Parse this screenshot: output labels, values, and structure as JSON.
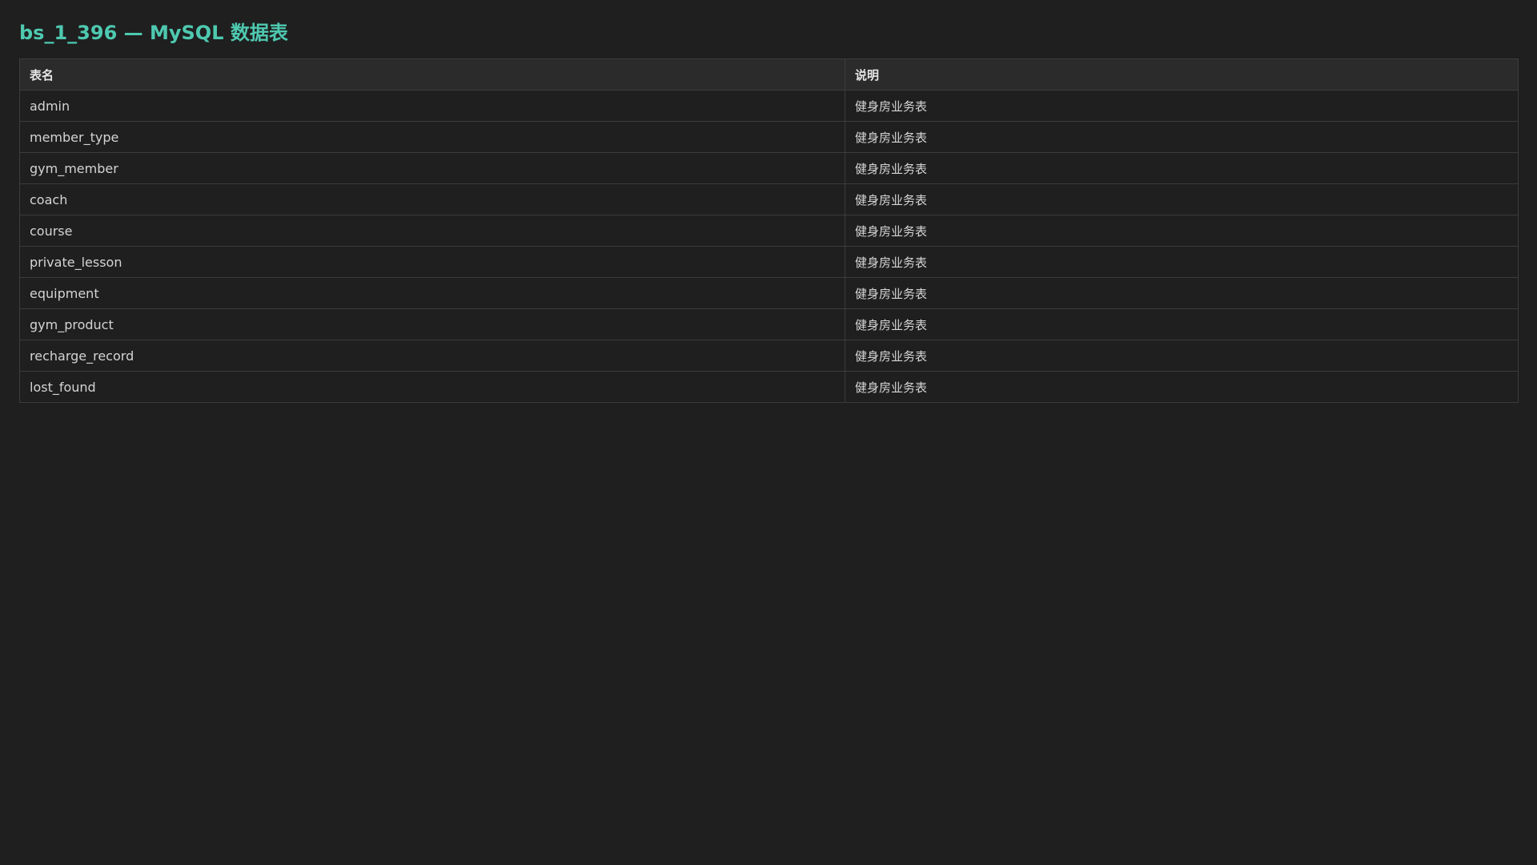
{
  "page": {
    "title": "bs_1_396 — MySQL 数据表"
  },
  "table": {
    "headers": [
      "表名",
      "说明"
    ],
    "rows": [
      {
        "name": "admin",
        "description": "健身房业务表"
      },
      {
        "name": "member_type",
        "description": "健身房业务表"
      },
      {
        "name": "gym_member",
        "description": "健身房业务表"
      },
      {
        "name": "coach",
        "description": "健身房业务表"
      },
      {
        "name": "course",
        "description": "健身房业务表"
      },
      {
        "name": "private_lesson",
        "description": "健身房业务表"
      },
      {
        "name": "equipment",
        "description": "健身房业务表"
      },
      {
        "name": "gym_product",
        "description": "健身房业务表"
      },
      {
        "name": "recharge_record",
        "description": "健身房业务表"
      },
      {
        "name": "lost_found",
        "description": "健身房业务表"
      }
    ]
  },
  "colors": {
    "background": "#1f1f1f",
    "title": "#4ec9b0",
    "header_background": "#2b2b2b",
    "border": "#3c3c3c",
    "text": "#d4d4d4"
  }
}
